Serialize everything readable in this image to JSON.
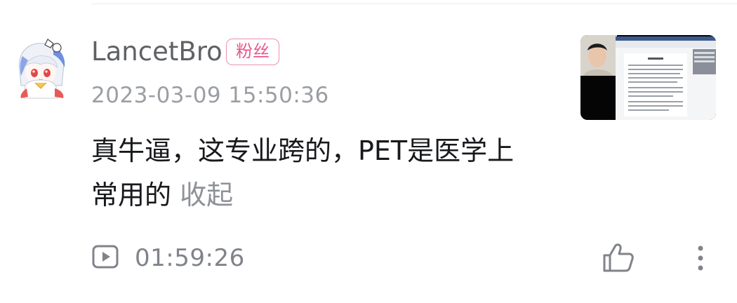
{
  "comment_item": {
    "username": "LancetBro",
    "badge": "粉丝",
    "timestamp": "2023-03-09 15:50:36",
    "text": "真牛逼，这专业跨的，PET是医学上常用的",
    "collapse_label": "收起",
    "video_timecode": "01:59:26"
  },
  "colors": {
    "badge_pink": "#e8568e",
    "username_gray": "#5f6165",
    "secondary_gray": "#9b9ea3",
    "text_dark": "#18191c"
  },
  "icons": {
    "play": "play-square-icon",
    "like": "thumbs-up-icon",
    "more": "vertical-dots-icon"
  }
}
